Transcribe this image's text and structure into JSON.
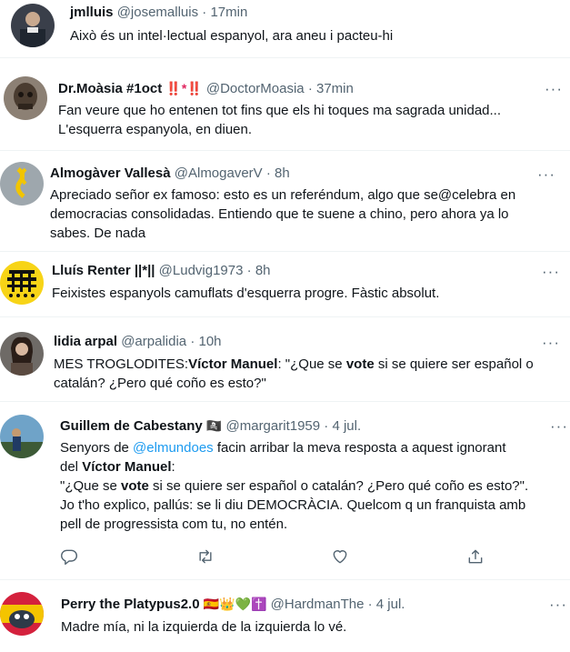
{
  "tweets": [
    {
      "name": "jmlluis",
      "handle": "@josemalluis",
      "time": "17min",
      "lines": [
        "Això és un intel·lectual espanyol, ara aneu i pacteu-hi"
      ]
    },
    {
      "name": "Dr.Moàsia #1oct",
      "badges": "‼️*‼️",
      "handle": "@DoctorMoasia",
      "time": "37min",
      "lines": [
        "Fan veure que ho entenen tot fins que els hi toques ma sagrada unidad...",
        "L'esquerra espanyola, en diuen."
      ]
    },
    {
      "name": "Almogàver Vallesà",
      "handle": "@AlmogaverV",
      "time": "8h",
      "lines": [
        "Apreciado señor ex famoso: esto es un referéndum, algo que se@celebra en",
        "democracias consolidadas. Entiendo que te suene a chino, pero ahora ya lo",
        "sabes. De nada"
      ]
    },
    {
      "name": "Lluís Renter ||*||",
      "handle": "@Ludvig1973",
      "time": "8h",
      "lines": [
        "Feixistes espanyols camuflats d'esquerra progre. Fàstic absolut."
      ]
    },
    {
      "name": "lidia arpal",
      "handle": "@arpalidia",
      "time": "10h",
      "line1_a": "MES TROGLODITES:",
      "line1_b": "Víctor Manuel",
      "line1_c": ": \"¿Que se ",
      "line1_d": "vote",
      "line1_e": " si se quiere ser español o",
      "line2": "catalán? ¿Pero qué coño es esto?\""
    },
    {
      "name": "Guillem de Cabestany",
      "badges": "🏴‍☠️",
      "handle": "@margarit1959",
      "time": "4 jul.",
      "l1_a": "Senyors de ",
      "l1_link": "@elmundoes",
      "l1_b": " facin arribar la meva resposta a aquest ignorant",
      "l2_a": "del ",
      "l2_b": "Víctor Manuel",
      "l2_c": ":",
      "l3_a": "\"¿Que se ",
      "l3_b": "vote",
      "l3_c": " si se quiere ser español o catalán? ¿Pero qué coño es esto?\".",
      "l4": "Jo t'ho explico, pallús: se li diu DEMOCRÀCIA. Quelcom q un franquista amb",
      "l5": "pell de progressista com tu, no entén."
    },
    {
      "name": "Perry the Platypus2.0",
      "badges": "🇪🇸👑💚✝️",
      "handle": "@HardmanThe",
      "time": "4 jul.",
      "lines": [
        "Madre mía, ni la izquierda de la izquierda lo vé."
      ]
    }
  ],
  "ui": {
    "more": "···",
    "dot": "·"
  },
  "icons": [
    "reply-icon",
    "retweet-icon",
    "like-icon",
    "share-icon",
    "more-icon"
  ],
  "colors": {
    "accent": "#1d9bf0",
    "text": "#0f1419",
    "secondary": "#536471",
    "separator": "#eff3f4"
  }
}
